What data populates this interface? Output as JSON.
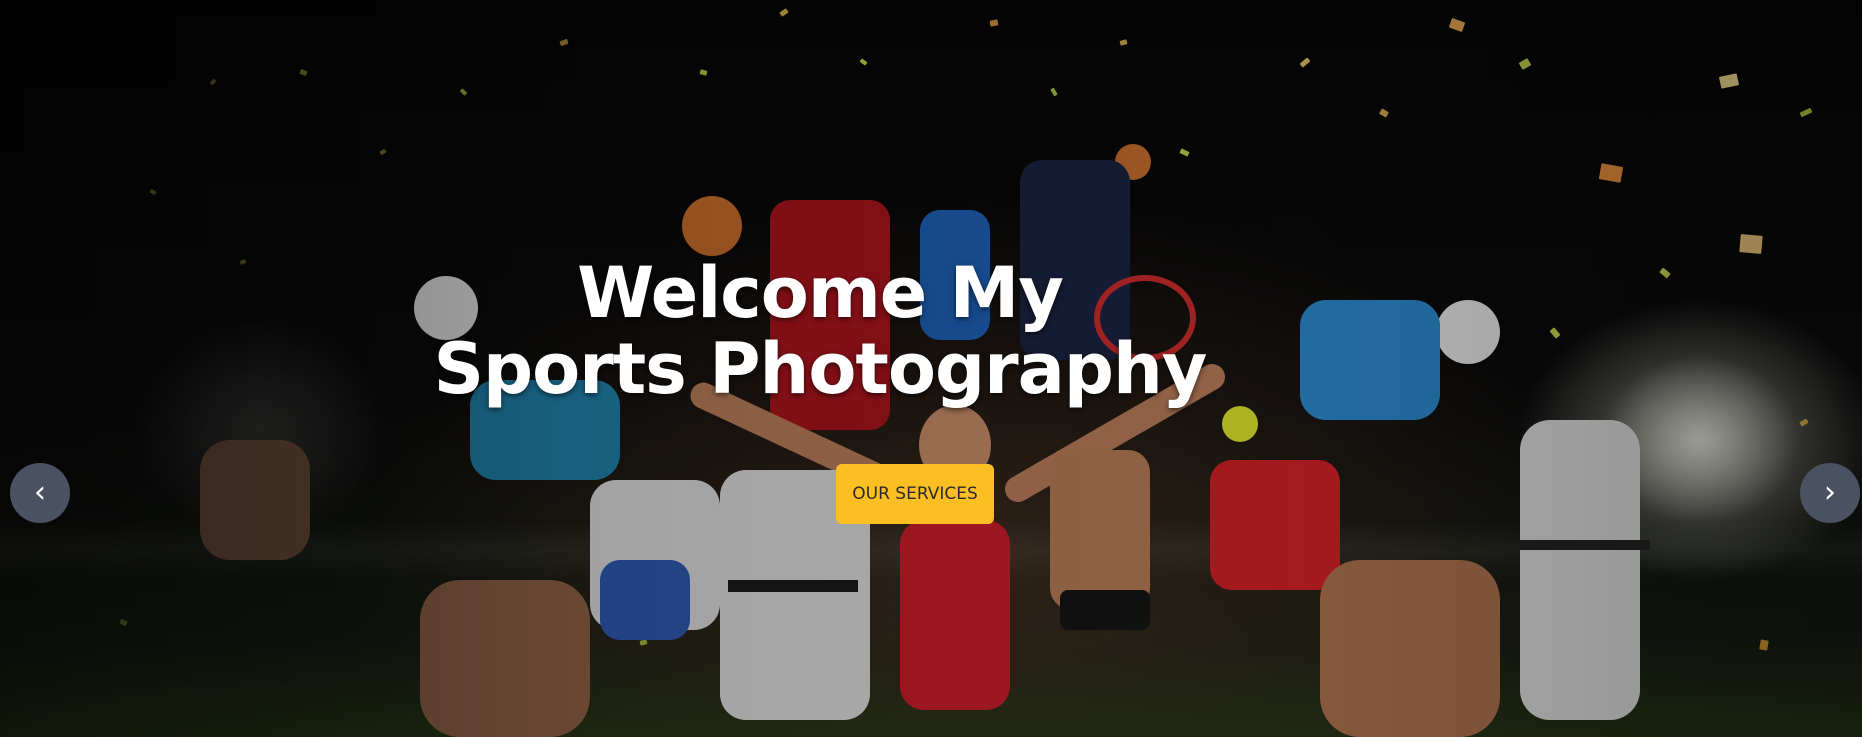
{
  "hero": {
    "title_line1": "Welcome My",
    "title_line2": "Sports Photography",
    "cta_label": "OUR SERVICES",
    "prev_glyph": "‹",
    "next_glyph": "›"
  },
  "colors": {
    "accent": "#fbbf24",
    "arrow_bg": "#4a5160",
    "title": "#ffffff"
  },
  "icons": {
    "prev": "chevron-left-icon",
    "next": "chevron-right-icon"
  }
}
